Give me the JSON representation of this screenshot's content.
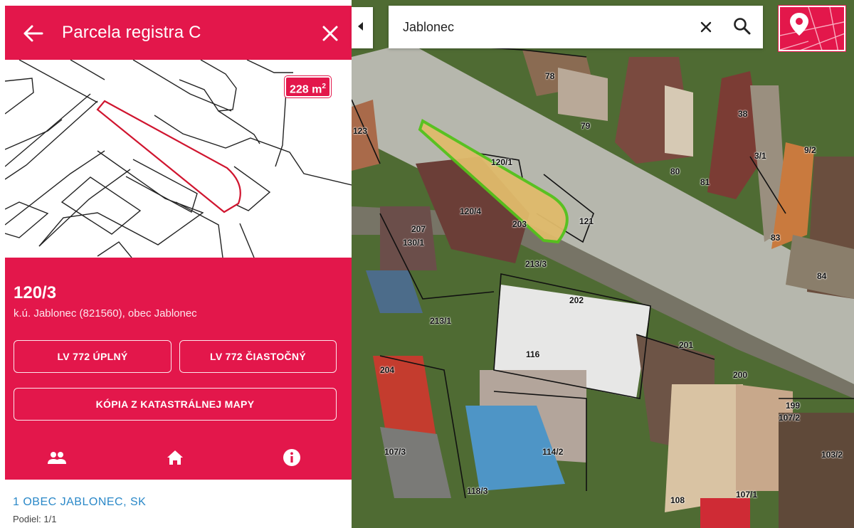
{
  "header": {
    "title": "Parcela registra C",
    "back_icon": "arrow-left-icon",
    "close_icon": "close-icon"
  },
  "minimap": {
    "area_value": "228 m",
    "area_sup": "2"
  },
  "parcel": {
    "number": "120/3",
    "location": "k.ú. Jablonec (821560), obec Jablonec"
  },
  "buttons": {
    "lv_full": "LV 772 ÚPLNÝ",
    "lv_partial": "LV 772 ČIASTOČNÝ",
    "map_copy": "KÓPIA Z KATASTRÁLNEJ MAPY"
  },
  "tabs": [
    {
      "icon": "people-icon"
    },
    {
      "icon": "home-icon"
    },
    {
      "icon": "info-icon"
    }
  ],
  "owner": {
    "name": "1  OBEC JABLONEC, SK",
    "share": "Podiel: 1/1"
  },
  "search": {
    "value": "Jablonec",
    "clear_icon": "close-icon",
    "search_icon": "search-icon"
  },
  "map": {
    "lot_labels": [
      "78",
      "79",
      "38",
      "80",
      "81",
      "123",
      "120/1",
      "120/4",
      "203",
      "121",
      "207",
      "130/1",
      "213/3",
      "202",
      "84",
      "83",
      "213/1",
      "116",
      "201",
      "204",
      "200",
      "199",
      "107/2",
      "107/3",
      "114/2",
      "118/3",
      "107/1",
      "108",
      "103/2",
      "3/1",
      "9/2"
    ]
  },
  "colors": {
    "brand": "#e3174b",
    "owner_link": "#2a88c8",
    "parcel_highlight": "#55c21b"
  }
}
